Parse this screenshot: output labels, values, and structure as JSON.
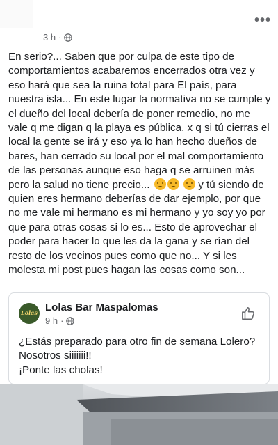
{
  "post": {
    "time": "3 h",
    "separator": "·",
    "visibility_icon": "globe-icon",
    "more_icon": "more-options-icon",
    "more_label": "•••",
    "text": "En serio?... Saben que por culpa de este tipo de comportamientos acabaremos encerrados otra vez y eso hará que sea la ruina total para El país, para nuestra isla... En este lugar la normativa no se cumple y el dueño del local debería de poner remedio, no me vale q me digan q la playa es pública, x q si tú cierras el local la gente se irá y eso ya lo han hecho dueños de bares, han cerrado su local por el mal comportamiento de las personas aunque eso haga q se arruinen más pero la salud no tiene precio...",
    "text_after_emoji": "y tú siendo de quien eres hermano deberías de dar ejemplo, por que no me vale mi hermano es mi hermano y yo soy yo por que para otras cosas si lo es... Esto de aprovechar el poder para hacer lo que les da la gana y se rían del resto de los vecinos pues como que no... Y si les molesta mi post pues hagan las cosas como son...",
    "emoji_name": "sad-face-emoji"
  },
  "shared_post": {
    "page_name": "Lolas Bar Maspalomas",
    "avatar_text": "Lolas",
    "time": "9 h",
    "separator": "·",
    "visibility_icon": "globe-icon",
    "like_icon": "thumbs-up-icon",
    "text_line1": "¿Estás preparado para otro fin de semana Lolero?",
    "text_line2": "Nosotros siiiiiii!!",
    "text_line3": "¡Ponte las cholas!"
  },
  "colors": {
    "text": "#1c1e21",
    "secondary": "#65676b",
    "border": "#dadde1",
    "emoji": "#f7b928"
  }
}
